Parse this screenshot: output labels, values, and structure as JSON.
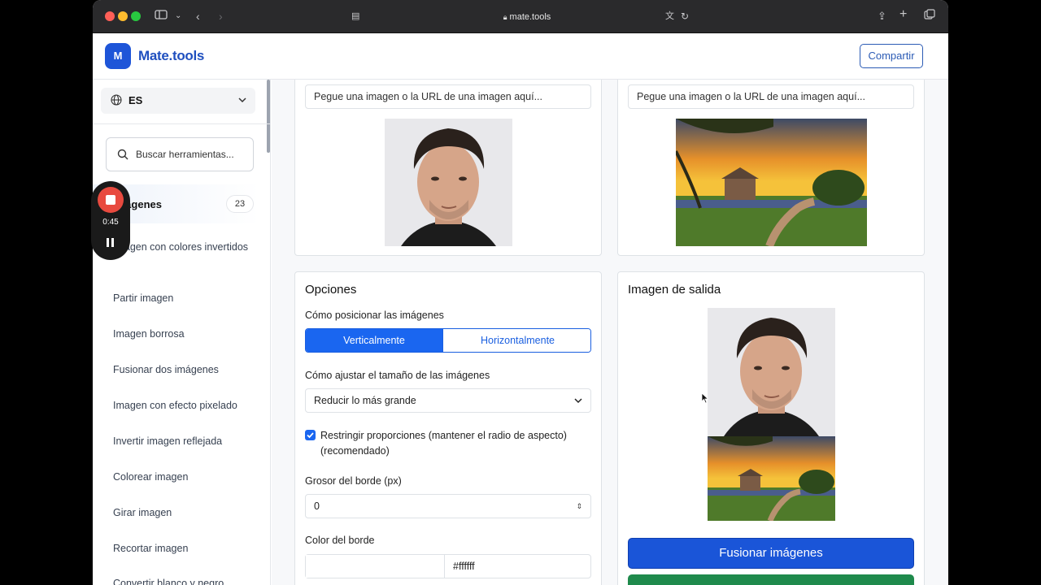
{
  "browser": {
    "url": "mate.tools"
  },
  "header": {
    "logo_letter": "M",
    "brand": "Mate.tools",
    "share_label": "Compartir"
  },
  "sidebar": {
    "language": "ES",
    "search_placeholder": "Buscar herramientas...",
    "category": {
      "name": "Imágenes",
      "count": "23"
    },
    "items": [
      "Imagen con colores invertidos",
      "Partir imagen",
      "Imagen borrosa",
      "Fusionar dos imágenes",
      "Imagen con efecto pixelado",
      "Invertir imagen reflejada",
      "Colorear imagen",
      "Girar imagen",
      "Recortar imagen",
      "Convertir blanco y negro"
    ]
  },
  "inputs": {
    "left_paste_placeholder": "Pegue una imagen o la URL de una imagen aquí...",
    "right_paste_placeholder": "Pegue una imagen o la URL de una imagen aquí..."
  },
  "options": {
    "title": "Opciones",
    "position_label": "Cómo posicionar las imágenes",
    "position_options": [
      "Verticalmente",
      "Horizontalmente"
    ],
    "position_selected": "Verticalmente",
    "resize_label": "Cómo ajustar el tamaño de las imágenes",
    "resize_value": "Reducir lo más grande",
    "constrain_label": "Restringir proporciones (mantener el radio de aspecto) (recomendado)",
    "constrain_checked": true,
    "border_width_label": "Grosor del borde (px)",
    "border_width_value": "0",
    "border_color_label": "Color del borde",
    "border_color_value": "#ffffff"
  },
  "output": {
    "title": "Imagen de salida",
    "merge_button": "Fusionar imágenes"
  },
  "recorder": {
    "time": "0:45"
  },
  "colors": {
    "accent": "#1a66f0",
    "brand": "#1f4fbf",
    "recorder_red": "#e84a3f"
  }
}
